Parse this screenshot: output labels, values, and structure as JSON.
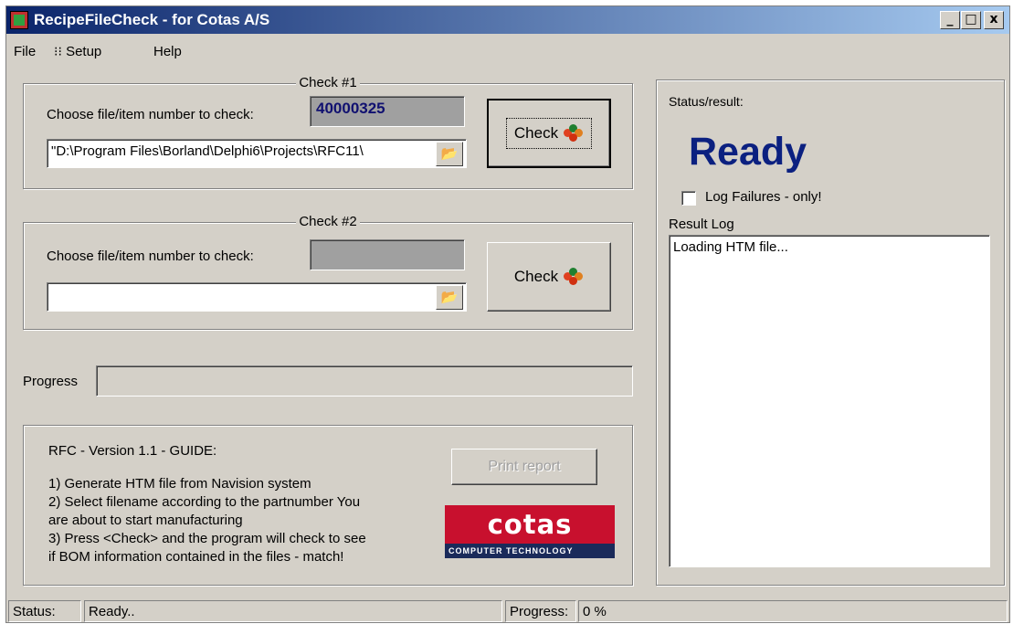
{
  "window": {
    "title": "RecipeFileCheck - for Cotas A/S",
    "minimize": "_",
    "maximize": "□",
    "close": "x"
  },
  "menu": {
    "file": "File",
    "setup": "Setup",
    "help": "Help"
  },
  "check1": {
    "legend": "Check #1",
    "choose_label": "Choose file/item number to check:",
    "item_number": "40000325",
    "path": "\"D:\\Program Files\\Borland\\Delphi6\\Projects\\RFC11\\",
    "check_button": "Check"
  },
  "check2": {
    "legend": "Check #2",
    "choose_label": "Choose file/item number to check:",
    "item_number": "",
    "path": "",
    "check_button": "Check"
  },
  "progress": {
    "label": "Progress",
    "value_fraction": 0
  },
  "guide": {
    "title": "RFC - Version 1.1 - GUIDE:",
    "step1": "1) Generate HTM file from Navision system",
    "step2a": "2) Select filename according to the partnumber You",
    "step2b": "are about to start manufacturing",
    "step3a": "3) Press <Check> and the program will check to see",
    "step3b": "if BOM information contained in the files - match!",
    "print_button": "Print report"
  },
  "logo": {
    "word": "cotas",
    "tagline": "COMPUTER TECHNOLOGY"
  },
  "status_panel": {
    "label": "Status/result:",
    "state": "Ready",
    "log_failures_label": "Log Failures - only!",
    "log_failures_checked": false,
    "result_log_label": "Result Log",
    "log_lines": [
      "Loading HTM file..."
    ]
  },
  "statusbar": {
    "status_label": "Status:",
    "status_value": "Ready..",
    "progress_label": "Progress:",
    "progress_value": "0 %"
  },
  "colors": {
    "titlebar": "#0a246a",
    "ready_text": "#0b2080",
    "logo_red": "#c8102e"
  },
  "icons": [
    "app-icon",
    "setup-icon",
    "folder-open-icon",
    "check-balls-icon"
  ]
}
